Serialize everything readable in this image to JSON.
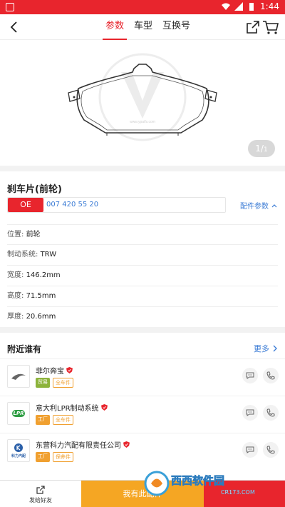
{
  "status_bar": {
    "time": "1:44"
  },
  "header": {
    "tabs": [
      {
        "label": "参数",
        "active": true
      },
      {
        "label": "车型",
        "active": false
      },
      {
        "label": "互换号",
        "active": false
      }
    ]
  },
  "gallery": {
    "current": "1",
    "total": "1",
    "watermark_url": "www.ypaifs.com"
  },
  "part": {
    "title": "刹车片(前轮)",
    "oe_label": "OE",
    "oe_number": "007 420 55 20",
    "config_link": "配件参数",
    "specs": [
      {
        "label": "位置:",
        "value": "前轮"
      },
      {
        "label": "制动系统:",
        "value": "TRW"
      },
      {
        "label": "宽度:",
        "value": "146.2mm"
      },
      {
        "label": "高度:",
        "value": "71.5mm"
      },
      {
        "label": "厚度:",
        "value": "20.6mm"
      }
    ]
  },
  "nearby": {
    "title": "附近谁有",
    "more": "更多",
    "shops": [
      {
        "name": "菲尔奔宝",
        "tags": [
          "贸易",
          "全车件"
        ],
        "logo_text": ""
      },
      {
        "name": "意大利LPR制动系统",
        "tags": [
          "工厂",
          "全车件"
        ],
        "logo_text": "LPR"
      },
      {
        "name": "东营科力汽配有限责任公司",
        "tags": [
          "工厂",
          "保养件"
        ],
        "logo_text": "科力汽配"
      }
    ]
  },
  "bottom": {
    "send_friend": "发给好友",
    "have_button": "我有此配件"
  },
  "colors": {
    "brand_red": "#e8252d",
    "link_blue": "#3a7bd5",
    "orange": "#f5a623"
  },
  "watermark": {
    "text": "西西软件园",
    "subtext": "CR173.COM"
  }
}
